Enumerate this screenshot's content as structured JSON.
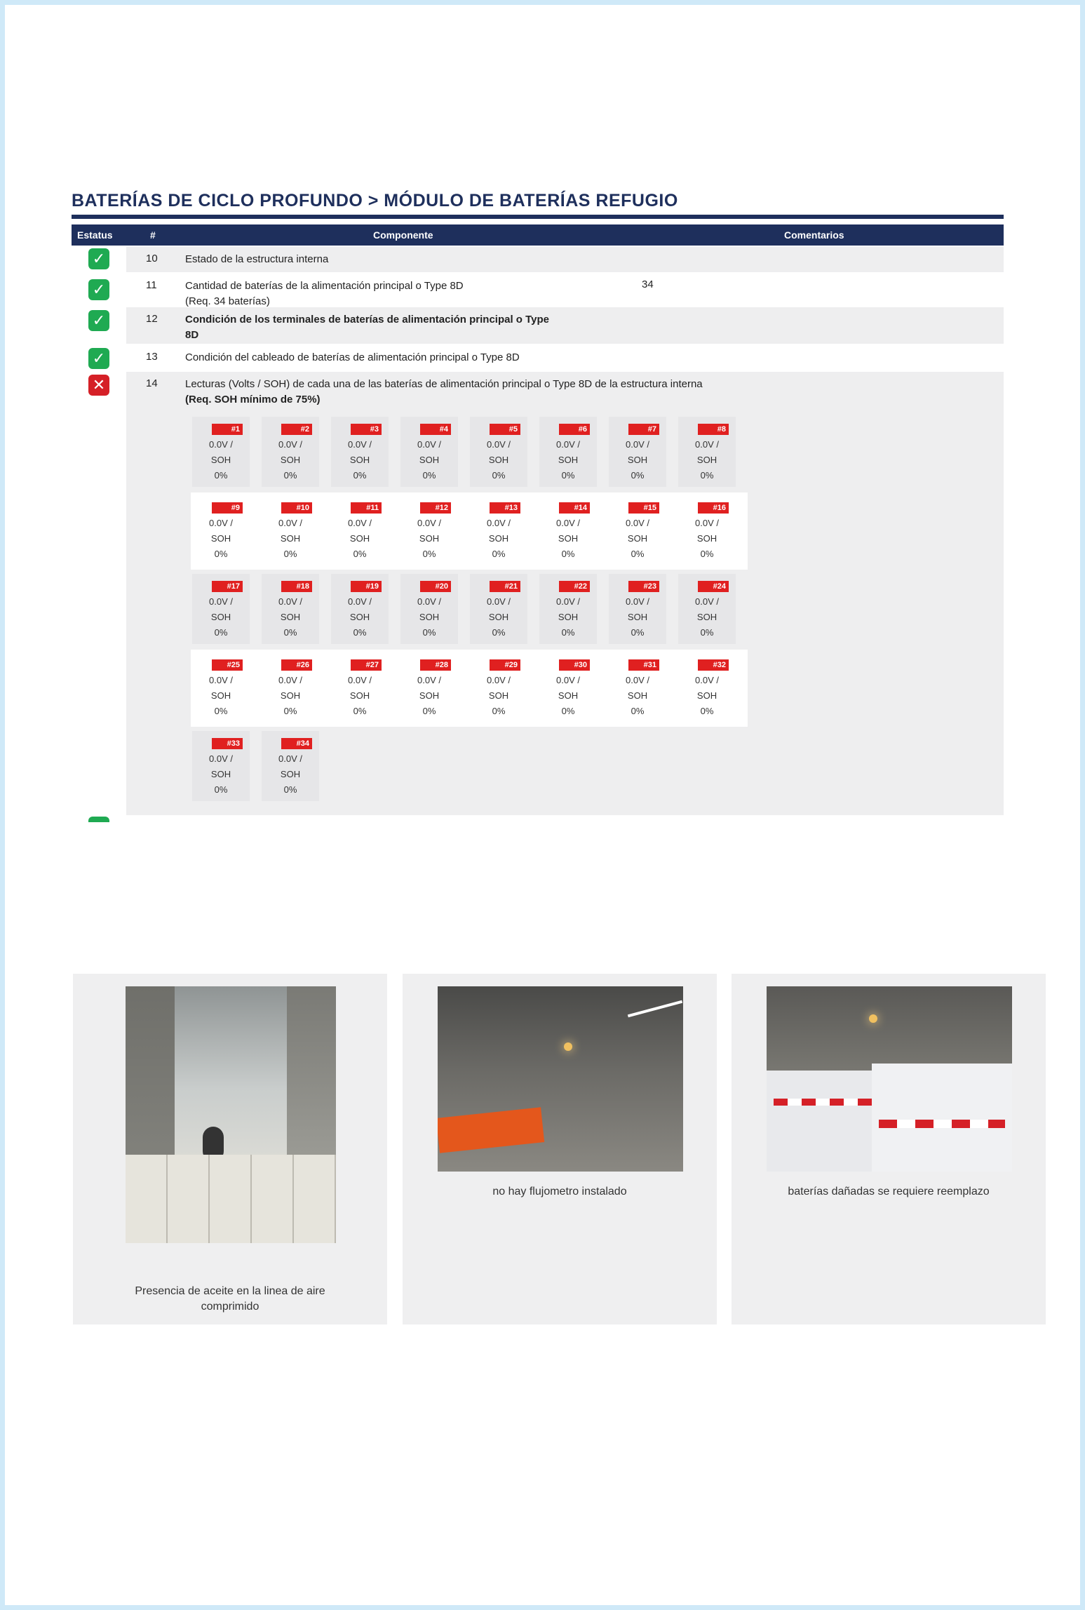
{
  "section": {
    "title": "BATERÍAS DE CICLO PROFUNDO > MÓDULO DE BATERÍAS REFUGIO"
  },
  "table": {
    "headers": {
      "status": "Estatus",
      "num": "#",
      "component": "Componente",
      "comment": "Comentarios"
    },
    "rows": [
      {
        "num": "10",
        "status": "ok",
        "text": "Estado de la estructura interna",
        "comment": ""
      },
      {
        "num": "11",
        "status": "ok",
        "text": "Cantidad de baterías de la alimentación principal o Type 8D",
        "text2": "(Req. 34 baterías)",
        "comment": "34"
      },
      {
        "num": "12",
        "status": "ok",
        "text": "Condición de los terminales de baterías de alimentación principal o Type",
        "text2": "8D",
        "comment": ""
      },
      {
        "num": "13",
        "status": "ok",
        "text": "Condición del cableado de baterías de alimentación principal o Type 8D",
        "comment": ""
      },
      {
        "num": "14",
        "status": "fail",
        "text": "Lecturas (Volts / SOH) de cada una de las baterías de alimentación principal o Type 8D de la estructura interna",
        "text2": "(Req. SOH mínimo de 75%)",
        "comment": ""
      }
    ]
  },
  "batteries": {
    "volt": "0.0V /",
    "soh_label": "SOH",
    "soh_value": "0%",
    "ids": [
      "#1",
      "#2",
      "#3",
      "#4",
      "#5",
      "#6",
      "#7",
      "#8",
      "#9",
      "#10",
      "#11",
      "#12",
      "#13",
      "#14",
      "#15",
      "#16",
      "#17",
      "#18",
      "#19",
      "#20",
      "#21",
      "#22",
      "#23",
      "#24",
      "#25",
      "#26",
      "#27",
      "#28",
      "#29",
      "#30",
      "#31",
      "#32",
      "#33",
      "#34"
    ]
  },
  "photos": [
    {
      "caption1": "Presencia de aceite en la linea de aire",
      "caption2": "comprimido"
    },
    {
      "caption1": "no hay flujometro instalado",
      "caption2": ""
    },
    {
      "caption1": "baterías dañadas se requiere reemplazo",
      "caption2": ""
    }
  ],
  "colors": {
    "navy": "#1e2f5c",
    "ok": "#1faa52",
    "fail": "#d52027",
    "tag": "#e02020"
  }
}
